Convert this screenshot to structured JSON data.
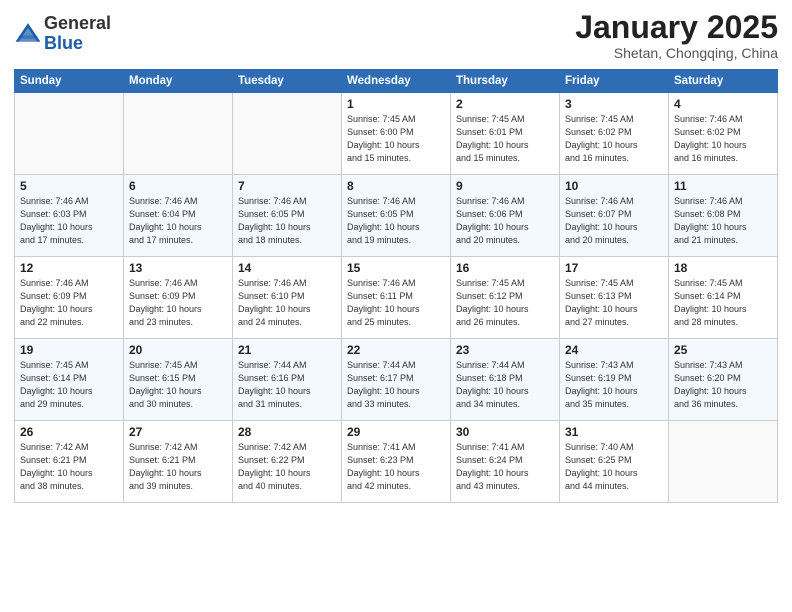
{
  "logo": {
    "text_general": "General",
    "text_blue": "Blue"
  },
  "title": "January 2025",
  "location": "Shetan, Chongqing, China",
  "days_of_week": [
    "Sunday",
    "Monday",
    "Tuesday",
    "Wednesday",
    "Thursday",
    "Friday",
    "Saturday"
  ],
  "weeks": [
    [
      {
        "day": "",
        "info": ""
      },
      {
        "day": "",
        "info": ""
      },
      {
        "day": "",
        "info": ""
      },
      {
        "day": "1",
        "info": "Sunrise: 7:45 AM\nSunset: 6:00 PM\nDaylight: 10 hours\nand 15 minutes."
      },
      {
        "day": "2",
        "info": "Sunrise: 7:45 AM\nSunset: 6:01 PM\nDaylight: 10 hours\nand 15 minutes."
      },
      {
        "day": "3",
        "info": "Sunrise: 7:45 AM\nSunset: 6:02 PM\nDaylight: 10 hours\nand 16 minutes."
      },
      {
        "day": "4",
        "info": "Sunrise: 7:46 AM\nSunset: 6:02 PM\nDaylight: 10 hours\nand 16 minutes."
      }
    ],
    [
      {
        "day": "5",
        "info": "Sunrise: 7:46 AM\nSunset: 6:03 PM\nDaylight: 10 hours\nand 17 minutes."
      },
      {
        "day": "6",
        "info": "Sunrise: 7:46 AM\nSunset: 6:04 PM\nDaylight: 10 hours\nand 17 minutes."
      },
      {
        "day": "7",
        "info": "Sunrise: 7:46 AM\nSunset: 6:05 PM\nDaylight: 10 hours\nand 18 minutes."
      },
      {
        "day": "8",
        "info": "Sunrise: 7:46 AM\nSunset: 6:05 PM\nDaylight: 10 hours\nand 19 minutes."
      },
      {
        "day": "9",
        "info": "Sunrise: 7:46 AM\nSunset: 6:06 PM\nDaylight: 10 hours\nand 20 minutes."
      },
      {
        "day": "10",
        "info": "Sunrise: 7:46 AM\nSunset: 6:07 PM\nDaylight: 10 hours\nand 20 minutes."
      },
      {
        "day": "11",
        "info": "Sunrise: 7:46 AM\nSunset: 6:08 PM\nDaylight: 10 hours\nand 21 minutes."
      }
    ],
    [
      {
        "day": "12",
        "info": "Sunrise: 7:46 AM\nSunset: 6:09 PM\nDaylight: 10 hours\nand 22 minutes."
      },
      {
        "day": "13",
        "info": "Sunrise: 7:46 AM\nSunset: 6:09 PM\nDaylight: 10 hours\nand 23 minutes."
      },
      {
        "day": "14",
        "info": "Sunrise: 7:46 AM\nSunset: 6:10 PM\nDaylight: 10 hours\nand 24 minutes."
      },
      {
        "day": "15",
        "info": "Sunrise: 7:46 AM\nSunset: 6:11 PM\nDaylight: 10 hours\nand 25 minutes."
      },
      {
        "day": "16",
        "info": "Sunrise: 7:45 AM\nSunset: 6:12 PM\nDaylight: 10 hours\nand 26 minutes."
      },
      {
        "day": "17",
        "info": "Sunrise: 7:45 AM\nSunset: 6:13 PM\nDaylight: 10 hours\nand 27 minutes."
      },
      {
        "day": "18",
        "info": "Sunrise: 7:45 AM\nSunset: 6:14 PM\nDaylight: 10 hours\nand 28 minutes."
      }
    ],
    [
      {
        "day": "19",
        "info": "Sunrise: 7:45 AM\nSunset: 6:14 PM\nDaylight: 10 hours\nand 29 minutes."
      },
      {
        "day": "20",
        "info": "Sunrise: 7:45 AM\nSunset: 6:15 PM\nDaylight: 10 hours\nand 30 minutes."
      },
      {
        "day": "21",
        "info": "Sunrise: 7:44 AM\nSunset: 6:16 PM\nDaylight: 10 hours\nand 31 minutes."
      },
      {
        "day": "22",
        "info": "Sunrise: 7:44 AM\nSunset: 6:17 PM\nDaylight: 10 hours\nand 33 minutes."
      },
      {
        "day": "23",
        "info": "Sunrise: 7:44 AM\nSunset: 6:18 PM\nDaylight: 10 hours\nand 34 minutes."
      },
      {
        "day": "24",
        "info": "Sunrise: 7:43 AM\nSunset: 6:19 PM\nDaylight: 10 hours\nand 35 minutes."
      },
      {
        "day": "25",
        "info": "Sunrise: 7:43 AM\nSunset: 6:20 PM\nDaylight: 10 hours\nand 36 minutes."
      }
    ],
    [
      {
        "day": "26",
        "info": "Sunrise: 7:42 AM\nSunset: 6:21 PM\nDaylight: 10 hours\nand 38 minutes."
      },
      {
        "day": "27",
        "info": "Sunrise: 7:42 AM\nSunset: 6:21 PM\nDaylight: 10 hours\nand 39 minutes."
      },
      {
        "day": "28",
        "info": "Sunrise: 7:42 AM\nSunset: 6:22 PM\nDaylight: 10 hours\nand 40 minutes."
      },
      {
        "day": "29",
        "info": "Sunrise: 7:41 AM\nSunset: 6:23 PM\nDaylight: 10 hours\nand 42 minutes."
      },
      {
        "day": "30",
        "info": "Sunrise: 7:41 AM\nSunset: 6:24 PM\nDaylight: 10 hours\nand 43 minutes."
      },
      {
        "day": "31",
        "info": "Sunrise: 7:40 AM\nSunset: 6:25 PM\nDaylight: 10 hours\nand 44 minutes."
      },
      {
        "day": "",
        "info": ""
      }
    ]
  ]
}
